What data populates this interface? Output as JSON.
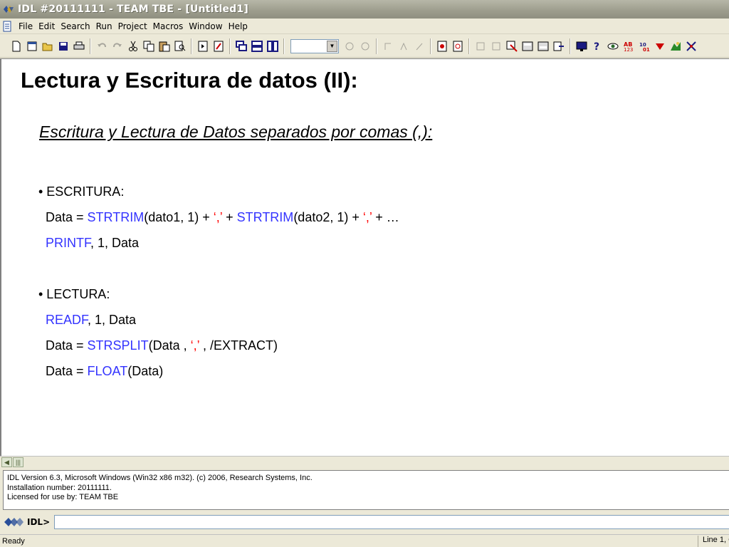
{
  "window": {
    "title": "IDL #20111111 - TEAM TBE - [Untitled1]",
    "icon": "idl-logo-icon"
  },
  "menubar": {
    "items": [
      "File",
      "Edit",
      "Search",
      "Run",
      "Project",
      "Macros",
      "Window",
      "Help"
    ]
  },
  "toolbar": {
    "combo_value": "",
    "icons": [
      "new-file-icon",
      "new-pro-icon",
      "open-folder-icon",
      "save-icon",
      "print-icon",
      "undo-icon",
      "redo-icon",
      "cut-icon",
      "copy-icon",
      "paste-icon",
      "find-icon",
      "compile-icon",
      "run-icon",
      "window-cascade-icon",
      "window-tile-h-icon",
      "window-tile-v-icon",
      "monitor-icon",
      "help-icon",
      "eye-icon",
      "colors-icon",
      "palette-icon"
    ]
  },
  "editor": {
    "title": "Lectura y Escritura de datos (II):",
    "subtitle": "Escritura y Lectura de Datos separados por comas (,):",
    "escritura_header": "• ESCRITURA:",
    "line1": {
      "a": "Data = ",
      "k1": "STRTRIM",
      "b": "(dato1, 1) + ",
      "c1": "‘,’",
      "d": " + ",
      "k2": "STRTRIM",
      "e": "(dato2, 1) + ",
      "c2": "‘,’",
      "f": " + …"
    },
    "line2": {
      "k": "PRINTF",
      "rest": ", 1, Data"
    },
    "lectura_header": "• LECTURA:",
    "line3": {
      "k": "READF",
      "rest": ", 1, Data"
    },
    "line4": {
      "a": "Data = ",
      "k": "STRSPLIT",
      "b": "(Data , ",
      "c": "‘,’",
      "d": " , /EXTRACT)"
    },
    "line5": {
      "a": "Data = ",
      "k": "FLOAT",
      "b": "(Data)"
    }
  },
  "output": {
    "lines": [
      "IDL Version 6.3, Microsoft Windows (Win32 x86 m32). (c) 2006, Research Systems, Inc.",
      "Installation number: 20111111.",
      "Licensed for use by: TEAM TBE"
    ]
  },
  "command": {
    "prompt": "IDL>",
    "value": ""
  },
  "status": {
    "text": "Ready",
    "position": "Line 1, C"
  },
  "colors": {
    "keyword": "#3333ff",
    "string": "#ff0000"
  }
}
